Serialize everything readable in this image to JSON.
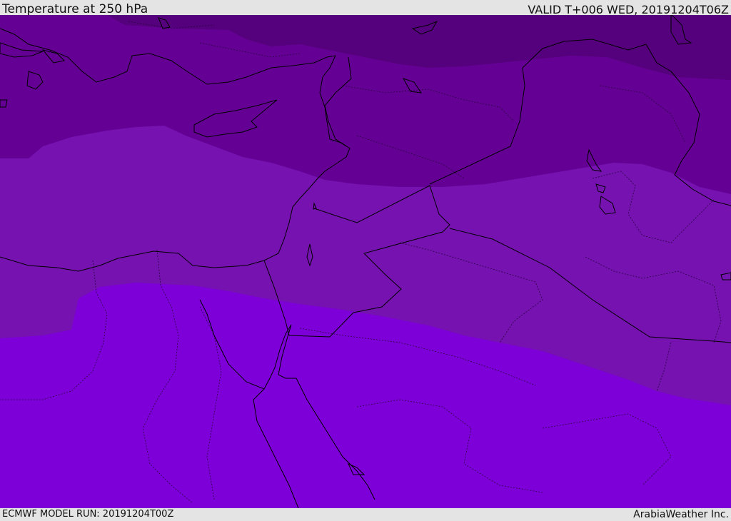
{
  "header": {
    "title": "Temperature at 250 hPa",
    "valid_time": "VALID T+006 WED, 20191204T06Z"
  },
  "footer": {
    "model_run": "ECMWF MODEL RUN: 20191204T00Z",
    "credit": "ArabiaWeather Inc."
  },
  "map": {
    "field": "temperature",
    "pressure_level_hpa": 250,
    "colors": {
      "band_darkest": "#55007c",
      "band_dark": "#650095",
      "band_mid": "#7512b0",
      "band_light": "#7d00d8",
      "coastline": "#000000",
      "border": "#2a0040"
    }
  }
}
